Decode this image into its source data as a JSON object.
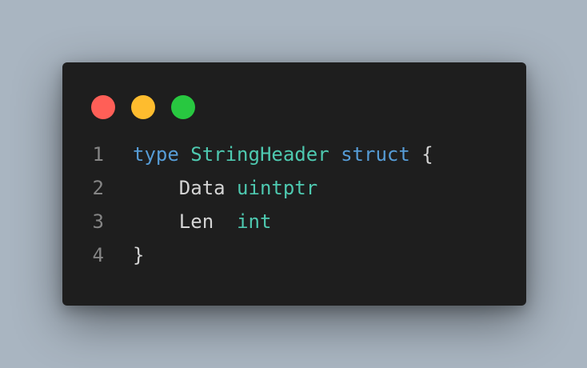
{
  "colors": {
    "background": "#a9b5c1",
    "window": "#1e1e1e",
    "close_dot": "#ff5f57",
    "minimize_dot": "#febc2e",
    "maximize_dot": "#28c840",
    "keyword": "#569cd6",
    "type": "#4ec9b0",
    "identifier": "#d4d4d4",
    "line_number": "#858585"
  },
  "window_controls": {
    "close": "close-dot",
    "minimize": "minimize-dot",
    "maximize": "maximize-dot"
  },
  "code": {
    "language": "go",
    "lines": [
      {
        "number": "1",
        "tokens": [
          {
            "text": "type",
            "kind": "keyword"
          },
          {
            "text": " ",
            "kind": "space"
          },
          {
            "text": "StringHeader",
            "kind": "type"
          },
          {
            "text": " ",
            "kind": "space"
          },
          {
            "text": "struct",
            "kind": "keyword"
          },
          {
            "text": " ",
            "kind": "space"
          },
          {
            "text": "{",
            "kind": "punct"
          }
        ]
      },
      {
        "number": "2",
        "tokens": [
          {
            "text": "    ",
            "kind": "space"
          },
          {
            "text": "Data",
            "kind": "ident"
          },
          {
            "text": " ",
            "kind": "space"
          },
          {
            "text": "uintptr",
            "kind": "type"
          }
        ]
      },
      {
        "number": "3",
        "tokens": [
          {
            "text": "    ",
            "kind": "space"
          },
          {
            "text": "Len",
            "kind": "ident"
          },
          {
            "text": "  ",
            "kind": "space"
          },
          {
            "text": "int",
            "kind": "type"
          }
        ]
      },
      {
        "number": "4",
        "tokens": [
          {
            "text": "}",
            "kind": "punct"
          }
        ]
      }
    ]
  }
}
